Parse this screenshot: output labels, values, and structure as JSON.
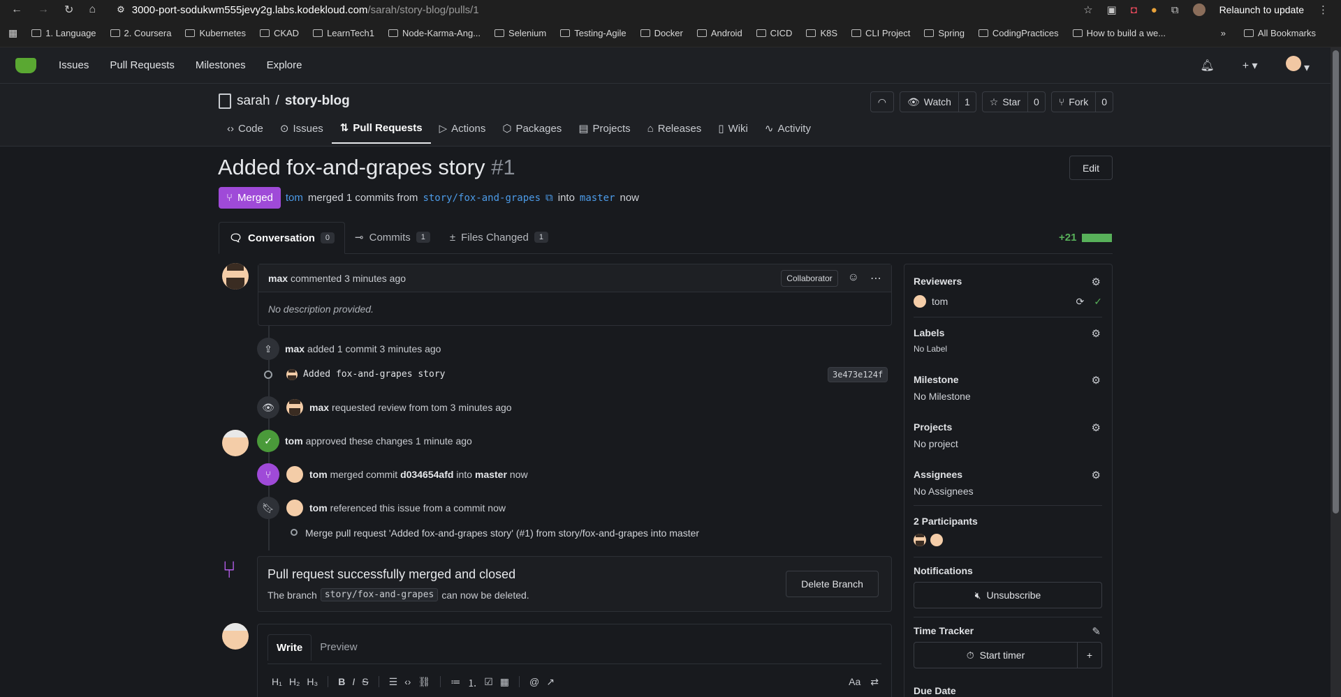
{
  "browser": {
    "url_host": "3000-port-sodukwm555jevy2g.labs.kodekloud.com",
    "url_path": "/sarah/story-blog/pulls/1",
    "relaunch": "Relaunch to update",
    "bookmarks": [
      "1. Language",
      "2. Coursera",
      "Kubernetes",
      "CKAD",
      "LearnTech1",
      "Node-Karma-Ang...",
      "Selenium",
      "Testing-Agile",
      "Docker",
      "Android",
      "CICD",
      "K8S",
      "CLI Project",
      "Spring",
      "CodingPractices",
      "How to build a we..."
    ],
    "all_bookmarks": "All Bookmarks"
  },
  "appnav": {
    "issues": "Issues",
    "pulls": "Pull Requests",
    "milestones": "Milestones",
    "explore": "Explore"
  },
  "repo": {
    "owner": "sarah",
    "sep": "/",
    "name": "story-blog",
    "watch": "Watch",
    "watch_count": "1",
    "star": "Star",
    "star_count": "0",
    "fork": "Fork",
    "fork_count": "0",
    "tabs": [
      "Code",
      "Issues",
      "Pull Requests",
      "Actions",
      "Packages",
      "Projects",
      "Releases",
      "Wiki",
      "Activity"
    ]
  },
  "pr": {
    "title": "Added fox-and-grapes story",
    "number": "#1",
    "edit": "Edit",
    "status": "Merged",
    "merger": "tom",
    "merged_text": "merged 1 commits from",
    "from_branch": "story/fox-and-grapes",
    "into_word": "into",
    "to_branch": "master",
    "when": "now"
  },
  "subtabs": {
    "conversation": "Conversation",
    "conversation_count": "0",
    "commits": "Commits",
    "commits_count": "1",
    "files": "Files Changed",
    "files_count": "1",
    "additions": "+21"
  },
  "comment": {
    "author": "max",
    "action": "commented 3 minutes ago",
    "role": "Collaborator",
    "body": "No description provided."
  },
  "timeline": {
    "e1_author": "max",
    "e1_text": "added 1 commit 3 minutes ago",
    "commit_msg": "Added fox-and-grapes story",
    "commit_sha": "3e473e124f",
    "e2_author": "max",
    "e2_text": "requested review from tom 3 minutes ago",
    "e3_author": "tom",
    "e3_text": "approved these changes 1 minute ago",
    "e4_author": "tom",
    "e4_text1": "merged commit",
    "e4_sha": "d034654afd",
    "e4_text2": "into",
    "e4_branch": "master",
    "e4_text3": "now",
    "e5_author": "tom",
    "e5_text": "referenced this issue from a commit now",
    "e5_commit": "Merge pull request 'Added fox-and-grapes story' (#1) from story/fox-and-grapes into master"
  },
  "mergebox": {
    "title": "Pull request successfully merged and closed",
    "sub1": "The branch",
    "branch": "story/fox-and-grapes",
    "sub2": "can now be deleted.",
    "delete": "Delete Branch"
  },
  "editor": {
    "write": "Write",
    "preview": "Preview"
  },
  "sidebar": {
    "reviewers": "Reviewers",
    "reviewer": "tom",
    "labels": "Labels",
    "labels_val": "No Label",
    "milestone": "Milestone",
    "milestone_val": "No Milestone",
    "projects": "Projects",
    "projects_val": "No project",
    "assignees": "Assignees",
    "assignees_val": "No Assignees",
    "participants": "2 Participants",
    "notifications": "Notifications",
    "unsubscribe": "Unsubscribe",
    "time_tracker": "Time Tracker",
    "start_timer": "Start timer",
    "due_date": "Due Date"
  },
  "colors": {
    "merged": "#9f4ad8",
    "approved": "#4a9a3a",
    "link": "#4c9be8",
    "additions": "#58b15a"
  }
}
